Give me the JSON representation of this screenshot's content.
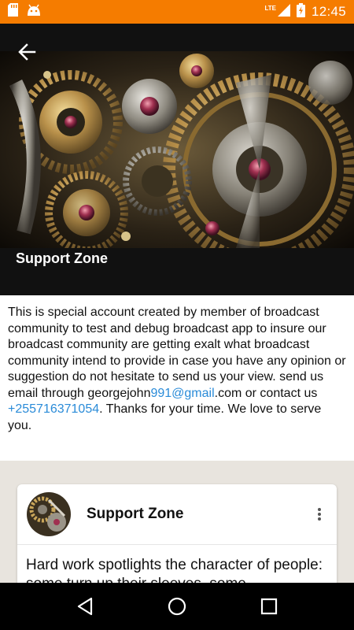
{
  "status_bar": {
    "time": "12:45",
    "network": "LTE",
    "icons": [
      "sd-card-icon",
      "android-icon",
      "signal-icon",
      "battery-charging-icon"
    ]
  },
  "header": {
    "title": "Support Zone",
    "back_icon": "arrow-back-icon"
  },
  "description": {
    "text_part1": "This is special account created by member of broadcast community to test and debug broadcast app to insure our broadcast community are getting exalt what broadcast community intend to provide in case you have any opinion or suggestion do not hesitate to send us your view. send us email through georgejohn",
    "email_link": "991@gmail",
    "text_part2": ".com or contact us ",
    "phone_link": "+255716371054",
    "text_part3": ". Thanks for your time. We love to serve you."
  },
  "post": {
    "author": "Support Zone",
    "body": "Hard work spotlights the character of people: some turn up their sleeves, some"
  },
  "colors": {
    "status_bar": "#f57c00",
    "link": "#2a8bd8",
    "header_bg": "#111111",
    "feed_bg": "#e8e4de"
  }
}
